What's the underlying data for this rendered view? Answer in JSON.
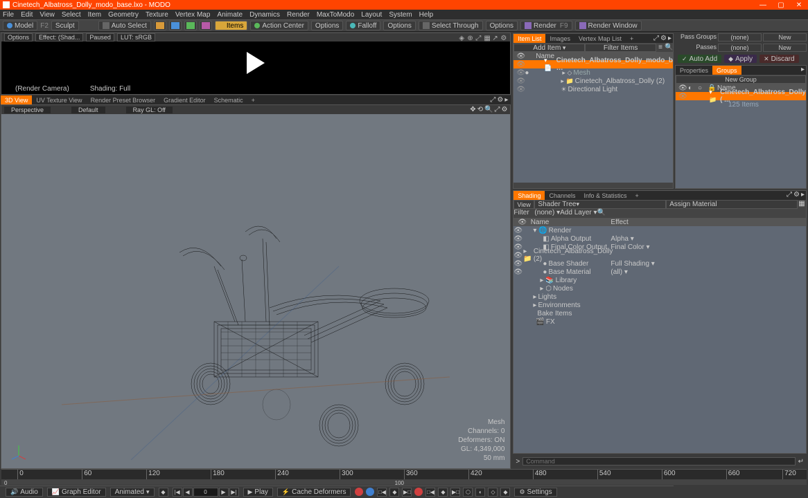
{
  "window": {
    "title": "Cinetech_Albatross_Dolly_modo_base.lxo - MODO"
  },
  "menus": [
    "File",
    "Edit",
    "View",
    "Select",
    "Item",
    "Geometry",
    "Texture",
    "Vertex Map",
    "Animate",
    "Dynamics",
    "Render",
    "MaxToModo",
    "Layout",
    "System",
    "Help"
  ],
  "toolbar": {
    "model": "Model",
    "f2": "F2",
    "sculpt": "Sculpt",
    "autoSelect": "Auto Select",
    "items": "Items",
    "actionCenter": "Action Center",
    "options1": "Options",
    "falloff": "Falloff",
    "options2": "Options",
    "selectThrough": "Select Through",
    "options3": "Options",
    "render": "Render",
    "renderWindow": "Render Window"
  },
  "preview": {
    "options": "Options",
    "effect": "Effect: (Shad...",
    "paused": "Paused",
    "lut": "LUT: sRGB",
    "camera": "(Render Camera)",
    "shading": "Shading: Full"
  },
  "viewTabs": [
    "3D View",
    "UV Texture View",
    "Render Preset Browser",
    "Gradient Editor",
    "Schematic",
    "+"
  ],
  "viewport": {
    "perspective": "Perspective",
    "default": "Default",
    "rayGL": "Ray GL: Off",
    "info": {
      "l1": "Mesh",
      "l2": "Channels: 0",
      "l3": "Deformers: ON",
      "l4": "GL: 4,349,000",
      "l5": "50 mm"
    }
  },
  "itemList": {
    "tabs": [
      "Item List",
      "Images",
      "Vertex Map List",
      "+"
    ],
    "addItem": "Add Item",
    "filterItems": "Filter Items",
    "headerName": "Name",
    "items": [
      {
        "indent": 0,
        "label": "Cinetech_Albatross_Dolly_modo_b …",
        "sel": true
      },
      {
        "indent": 1,
        "label": "Mesh"
      },
      {
        "indent": 1,
        "label": "Cinetech_Albatross_Dolly (2)"
      },
      {
        "indent": 1,
        "label": "Directional Light"
      }
    ]
  },
  "passGroups": {
    "label": "Pass Groups",
    "value": "(none)",
    "new": "New"
  },
  "passes": {
    "label": "Passes",
    "value": "(none)",
    "new": "New"
  },
  "actions": {
    "autoAdd": "Auto Add",
    "apply": "Apply",
    "discard": "Discard"
  },
  "properties": {
    "tabs": [
      "Properties",
      "Groups"
    ],
    "newGroup": "New Group",
    "headerName": "Name",
    "items": [
      {
        "label": "Cinetech_Albatross_Dolly ( ...",
        "sel": true
      },
      {
        "label": "125 Items"
      }
    ]
  },
  "shading": {
    "tabs": [
      "Shading",
      "Channels",
      "Info & Statistics",
      "+"
    ],
    "view": "View",
    "shaderTree": "Shader Tree",
    "assignMaterial": "Assign Material",
    "filter": "Filter",
    "none": "(none)",
    "addLayer": "Add Layer",
    "headerName": "Name",
    "headerEffect": "Effect",
    "rows": [
      {
        "indent": 0,
        "name": "Render",
        "effect": ""
      },
      {
        "indent": 1,
        "name": "Alpha Output",
        "effect": "Alpha"
      },
      {
        "indent": 1,
        "name": "Final Color Output",
        "effect": "Final Color"
      },
      {
        "indent": 1,
        "name": "Cinetech_Albatross_Dolly (2)",
        "effect": ""
      },
      {
        "indent": 1,
        "name": "Base Shader",
        "effect": "Full Shading"
      },
      {
        "indent": 1,
        "name": "Base Material",
        "effect": "(all)"
      },
      {
        "indent": 1,
        "name": "Library",
        "effect": ""
      },
      {
        "indent": 1,
        "name": "Nodes",
        "effect": ""
      },
      {
        "indent": 0,
        "name": "Lights",
        "effect": ""
      },
      {
        "indent": 0,
        "name": "Environments",
        "effect": ""
      },
      {
        "indent": 0,
        "name": "Bake Items",
        "effect": ""
      },
      {
        "indent": 0,
        "name": "FX",
        "effect": ""
      }
    ]
  },
  "timeline": {
    "ticks": [
      "0",
      "60",
      "120",
      "180",
      "240",
      "300",
      "360",
      "420",
      "480",
      "540",
      "600",
      "660",
      "720"
    ],
    "bottomLeft": "0",
    "bottomRight": "100"
  },
  "bottomBar": {
    "audio": "Audio",
    "graphEditor": "Graph Editor",
    "animated": "Animated",
    "frame": "0",
    "play": "Play",
    "cacheDeformers": "Cache Deformers",
    "settings": "Settings"
  },
  "command": {
    "prompt": ">",
    "placeholder": "Command"
  }
}
